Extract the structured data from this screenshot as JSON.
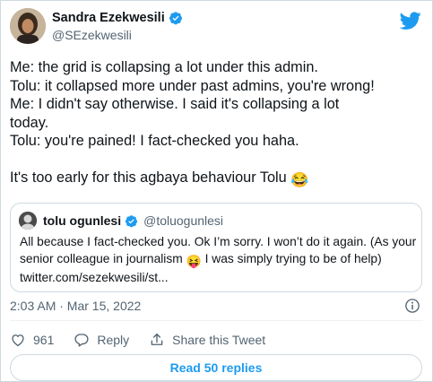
{
  "tweet": {
    "author": {
      "name": "Sandra Ezekwesili",
      "handle": "@SEzekwesili",
      "verified": true
    },
    "text_lines": [
      "Me: the grid is collapsing a lot under this admin.",
      "Tolu: it collapsed more under past admins, you're  wrong!",
      "Me: I didn't  say otherwise. I said it's  collapsing a lot",
      "today.",
      "Tolu: you're pained! I fact-checked you haha."
    ],
    "closing_text": "It's too early for this agbaya behaviour Tolu ",
    "closing_emoji": "😂",
    "timestamp": "2:03 AM · Mar 15, 2022"
  },
  "quoted_tweet": {
    "author": {
      "name": "tolu ogunlesi",
      "handle": "@toluogunlesi",
      "verified": true
    },
    "line1": "All because I fact-checked you. Ok I’m sorry. I won’t do it again. (As your",
    "line2_before": "senior colleague in journalism ",
    "line2_emoji": "😝",
    "line2_after": " I was simply trying to be of help)",
    "line3": "twitter.com/sezekwesili/st..."
  },
  "actions": {
    "like_count": "961",
    "reply_label": "Reply",
    "share_label": "Share this Tweet"
  },
  "read_replies_label": "Read 50 replies",
  "colors": {
    "brand_blue": "#1d9bf0",
    "secondary_text": "#536471",
    "border": "#cfd9de"
  },
  "icons": {
    "brand": "twitter-bird-icon",
    "verified": "verified-badge-icon",
    "info": "info-icon",
    "like": "heart-icon",
    "reply": "speech-bubble-icon",
    "share": "share-arrow-icon"
  }
}
